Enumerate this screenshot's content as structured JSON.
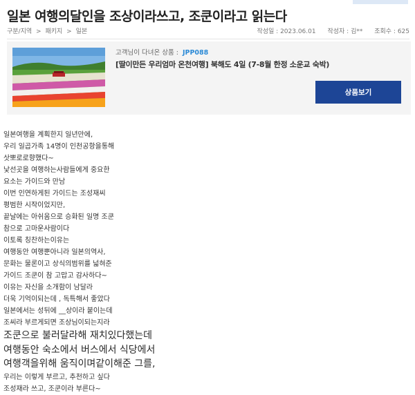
{
  "post": {
    "title": "일본 여행의달인을 조상이라쓰고, 조쿤이라고 읽는다",
    "breadcrumb": [
      "구분/지역",
      ">",
      "패키지",
      ">",
      "일본"
    ],
    "meta": {
      "date_label": "작성일 : 2023.06.01",
      "author_label": "작성자 : 김**",
      "views_label": "조회수 : 625"
    }
  },
  "product": {
    "label": "고객님이 다녀온 상품 :",
    "code": "JPP088",
    "name": "[딸이만든 우리엄마 온천여행] 북해도 4일 (7-8월 한정 소운교 숙박)",
    "button_label": "상품보기",
    "thumbnail_icon": "flower-field-image"
  },
  "content": {
    "lines": [
      {
        "text": "일본여행을 계획한지 일년만에,",
        "big": false
      },
      {
        "text": "우리 일곱가족 14명이 인천공항을통해",
        "big": false
      },
      {
        "text": "삿뽀로로향했다~",
        "big": false
      },
      {
        "text": "낯선곳을 여행하는사람들에게 중요한",
        "big": false
      },
      {
        "text": "요소는 가이드와 만남",
        "big": false
      },
      {
        "text": "이번 인연하게된 가이드는 조성재씨",
        "big": false
      },
      {
        "text": "평범한 시작이었지만,",
        "big": false
      },
      {
        "text": "끝날에는 아쉬움으로 승화된 일명 조쿤",
        "big": false
      },
      {
        "text": "참으로 고마운사람이다",
        "big": false
      },
      {
        "text": "이토록 칭찬하는이유는",
        "big": false
      },
      {
        "text": "여행동안 여행뿐아니라 일본의역사,",
        "big": false
      },
      {
        "text": "문화는 물론이고 상식의범위를 넓혀준",
        "big": false
      },
      {
        "text": "가이드 조쿤이 참 고맙고 감사하다~",
        "big": false
      },
      {
        "text": "이유는 자신을 소개함이 남달라",
        "big": false
      },
      {
        "text": "더욱 기억이되는데 , 독특해서 좋았다",
        "big": false
      },
      {
        "text": "일본에서는 성뒤에 __상이라 붙이는데",
        "big": false
      },
      {
        "text": "조씨라 부르게되면 조상님이되는지라",
        "big": false
      },
      {
        "text": "조쿤으로 불러달라해 재치있다했는데",
        "big": true
      },
      {
        "text": "여행동안 숙소에서 버스에서 식당에서",
        "big": true
      },
      {
        "text": "여행객을위해 움직이며같이해준 그를,",
        "big": true
      },
      {
        "text": "우리는 이렇게 부르고, 추천하고 싶다",
        "big": false
      },
      {
        "text": "조성재라 쓰고, 조쿤이라 부른다~",
        "big": false
      }
    ]
  },
  "colors": {
    "accent_blue": "#1d4596",
    "code_blue": "#2b8ad6",
    "box_bg": "#f4f4f4"
  }
}
